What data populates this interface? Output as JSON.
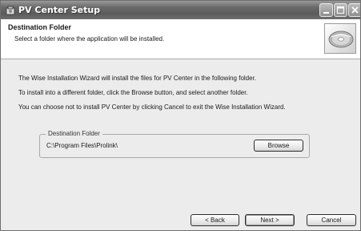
{
  "window": {
    "title": "PV Center Setup"
  },
  "header": {
    "title": "Destination Folder",
    "subtitle": "Select a folder where the application will be installed."
  },
  "body": {
    "paragraph1": "The Wise Installation Wizard will install the files for PV Center in the following folder.",
    "paragraph2": "To install into a different folder, click the Browse button, and select another folder.",
    "paragraph3": "You can choose not to install PV Center by clicking Cancel to exit the Wise Installation Wizard."
  },
  "destination": {
    "legend": "Destination Folder",
    "path": "C:\\Program Files\\Prolink\\",
    "browse_label": "Browse"
  },
  "footer": {
    "back_label": "< Back",
    "next_label": "Next >",
    "cancel_label": "Cancel"
  },
  "icons": {
    "app": "installer-icon",
    "header": "cd-disc-icon",
    "minimize": "minimize-icon",
    "maximize": "maximize-icon",
    "close": "close-icon"
  },
  "colors": {
    "titlebar": "#6a6a6a",
    "window_bg": "#ececec",
    "header_bg": "#ffffff"
  }
}
